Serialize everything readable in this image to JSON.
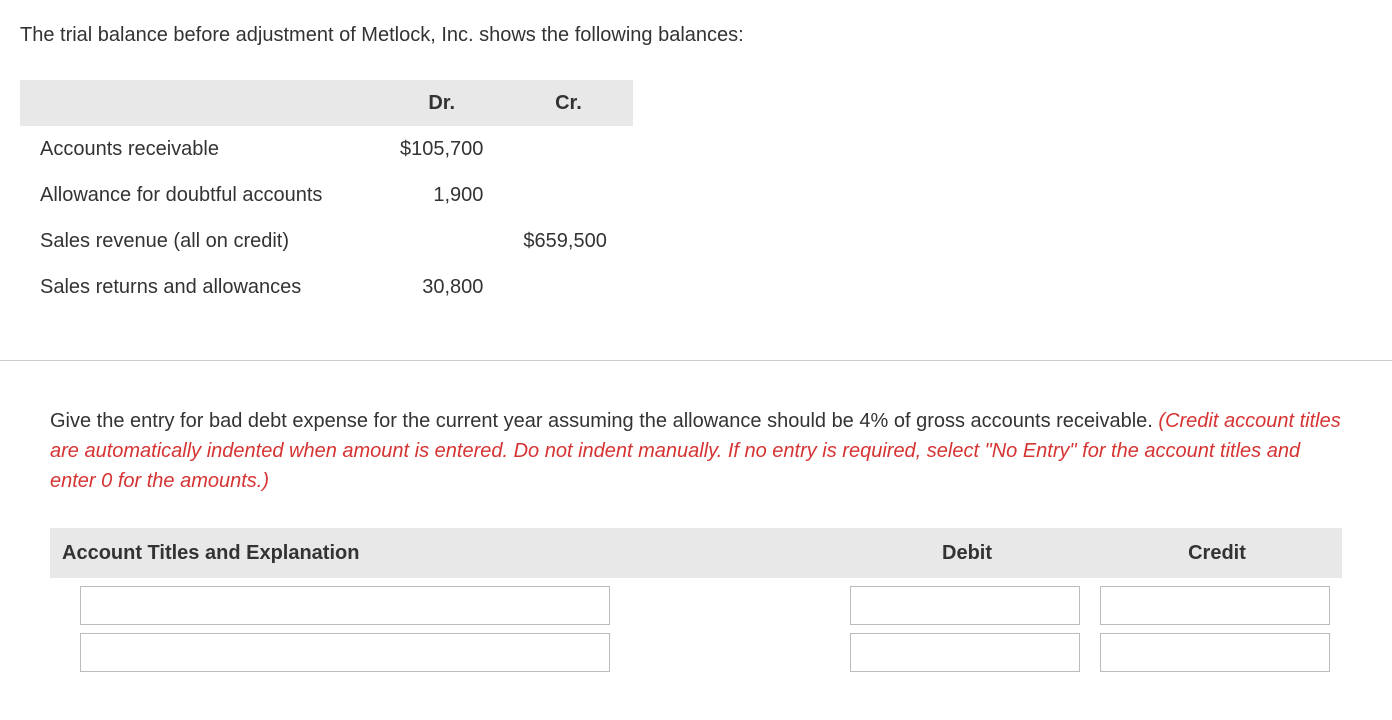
{
  "intro": "The trial balance before adjustment of Metlock, Inc. shows the following balances:",
  "trial_balance": {
    "headers": {
      "blank": "",
      "dr": "Dr.",
      "cr": "Cr."
    },
    "rows": [
      {
        "label": "Accounts receivable",
        "dr": "$105,700",
        "cr": ""
      },
      {
        "label": "Allowance for doubtful accounts",
        "dr": "1,900",
        "cr": ""
      },
      {
        "label": "Sales revenue (all on credit)",
        "dr": "",
        "cr": "$659,500"
      },
      {
        "label": "Sales returns and allowances",
        "dr": "30,800",
        "cr": ""
      }
    ]
  },
  "question": "Give the entry for bad debt expense for the current year assuming the allowance should be 4% of gross accounts receivable.",
  "instruction": "(Credit account titles are automatically indented when amount is entered. Do not indent manually. If no entry is required, select \"No Entry\" for the account titles and enter 0 for the amounts.)",
  "journal": {
    "headers": {
      "account": "Account Titles and Explanation",
      "debit": "Debit",
      "credit": "Credit"
    },
    "rows": [
      {
        "account": "",
        "debit": "",
        "credit": ""
      },
      {
        "account": "",
        "debit": "",
        "credit": ""
      }
    ]
  }
}
